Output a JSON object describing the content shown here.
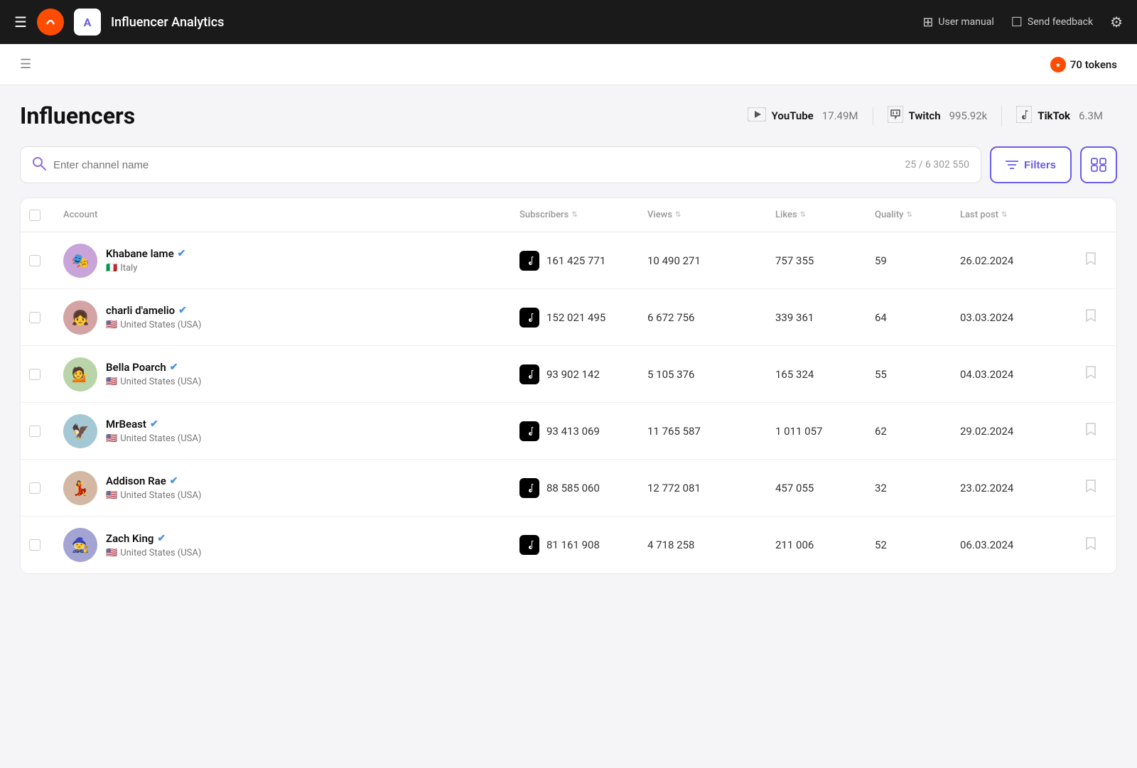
{
  "topNav": {
    "hamburger": "☰",
    "logoText": "●",
    "appIconText": "A",
    "appName": "Influencer Analytics",
    "userManual": "User manual",
    "sendFeedback": "Send feedback",
    "settingsIcon": "⚙"
  },
  "secondaryBar": {
    "menuIcon": "☰",
    "tokens": "70 tokens"
  },
  "page": {
    "title": "Influencers"
  },
  "platforms": [
    {
      "id": "youtube",
      "name": "YouTube",
      "count": "17.49M",
      "icon": "▶"
    },
    {
      "id": "twitch",
      "name": "Twitch",
      "count": "995.92k",
      "icon": "◈"
    },
    {
      "id": "tiktok",
      "name": "TikTok",
      "count": "6.3M",
      "icon": "♪"
    }
  ],
  "search": {
    "placeholder": "Enter channel name",
    "count": "25 / 6 302 550"
  },
  "filterBtn": "Filters",
  "table": {
    "columns": [
      "Account",
      "Subscribers",
      "Views",
      "Likes",
      "Quality",
      "Last post"
    ],
    "rows": [
      {
        "name": "Khabane lame",
        "verified": true,
        "country": "Italy",
        "flag": "🇮🇹",
        "platform": "TikTok",
        "subscribers": "161 425 771",
        "views": "10 490 271",
        "likes": "757 355",
        "quality": "59",
        "lastPost": "26.02.2024",
        "avatarClass": "av-khabane",
        "avatarEmoji": "🎭"
      },
      {
        "name": "charli d'amelio",
        "verified": true,
        "country": "United States (USA)",
        "flag": "🇺🇸",
        "platform": "TikTok",
        "subscribers": "152 021 495",
        "views": "6 672 756",
        "likes": "339 361",
        "quality": "64",
        "lastPost": "03.03.2024",
        "avatarClass": "av-charli",
        "avatarEmoji": "👧"
      },
      {
        "name": "Bella Poarch",
        "verified": true,
        "country": "United States (USA)",
        "flag": "🇺🇸",
        "platform": "TikTok",
        "subscribers": "93 902 142",
        "views": "5 105 376",
        "likes": "165 324",
        "quality": "55",
        "lastPost": "04.03.2024",
        "avatarClass": "av-bella",
        "avatarEmoji": "💁"
      },
      {
        "name": "MrBeast",
        "verified": true,
        "country": "United States (USA)",
        "flag": "🇺🇸",
        "platform": "TikTok",
        "subscribers": "93 413 069",
        "views": "11 765 587",
        "likes": "1 011 057",
        "quality": "62",
        "lastPost": "29.02.2024",
        "avatarClass": "av-mrbeast",
        "avatarEmoji": "🦅"
      },
      {
        "name": "Addison Rae",
        "verified": true,
        "country": "United States (USA)",
        "flag": "🇺🇸",
        "platform": "TikTok",
        "subscribers": "88 585 060",
        "views": "12 772 081",
        "likes": "457 055",
        "quality": "32",
        "lastPost": "23.02.2024",
        "avatarClass": "av-addison",
        "avatarEmoji": "💃"
      },
      {
        "name": "Zach King",
        "verified": true,
        "country": "United States (USA)",
        "flag": "🇺🇸",
        "platform": "TikTok",
        "subscribers": "81 161 908",
        "views": "4 718 258",
        "likes": "211 006",
        "quality": "52",
        "lastPost": "06.03.2024",
        "avatarClass": "av-zach",
        "avatarEmoji": "🧙"
      }
    ]
  }
}
